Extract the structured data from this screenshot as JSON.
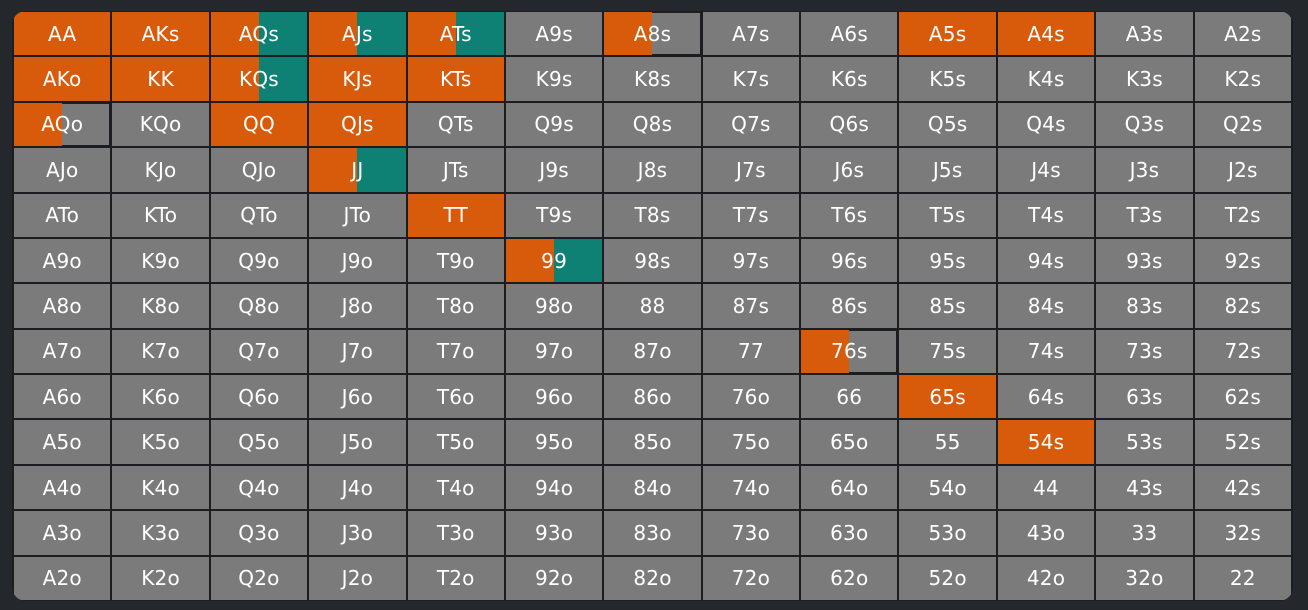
{
  "colors": {
    "raise": "#d85a0b",
    "call": "#0f8174",
    "fold": "#7b7b7b",
    "border": "#1b1d20"
  },
  "grid": {
    "rows": [
      [
        "AA",
        "AKs",
        "AQs",
        "AJs",
        "ATs",
        "A9s",
        "A8s",
        "A7s",
        "A6s",
        "A5s",
        "A4s",
        "A3s",
        "A2s"
      ],
      [
        "AKo",
        "KK",
        "KQs",
        "KJs",
        "KTs",
        "K9s",
        "K8s",
        "K7s",
        "K6s",
        "K5s",
        "K4s",
        "K3s",
        "K2s"
      ],
      [
        "AQo",
        "KQo",
        "QQ",
        "QJs",
        "QTs",
        "Q9s",
        "Q8s",
        "Q7s",
        "Q6s",
        "Q5s",
        "Q4s",
        "Q3s",
        "Q2s"
      ],
      [
        "AJo",
        "KJo",
        "QJo",
        "JJ",
        "JTs",
        "J9s",
        "J8s",
        "J7s",
        "J6s",
        "J5s",
        "J4s",
        "J3s",
        "J2s"
      ],
      [
        "ATo",
        "KTo",
        "QTo",
        "JTo",
        "TT",
        "T9s",
        "T8s",
        "T7s",
        "T6s",
        "T5s",
        "T4s",
        "T3s",
        "T2s"
      ],
      [
        "A9o",
        "K9o",
        "Q9o",
        "J9o",
        "T9o",
        "99",
        "98s",
        "97s",
        "96s",
        "95s",
        "94s",
        "93s",
        "92s"
      ],
      [
        "A8o",
        "K8o",
        "Q8o",
        "J8o",
        "T8o",
        "98o",
        "88",
        "87s",
        "86s",
        "85s",
        "84s",
        "83s",
        "82s"
      ],
      [
        "A7o",
        "K7o",
        "Q7o",
        "J7o",
        "T7o",
        "97o",
        "87o",
        "77",
        "76s",
        "75s",
        "74s",
        "73s",
        "72s"
      ],
      [
        "A6o",
        "K6o",
        "Q6o",
        "J6o",
        "T6o",
        "96o",
        "86o",
        "76o",
        "66",
        "65s",
        "64s",
        "63s",
        "62s"
      ],
      [
        "A5o",
        "K5o",
        "Q5o",
        "J5o",
        "T5o",
        "95o",
        "85o",
        "75o",
        "65o",
        "55",
        "54s",
        "53s",
        "52s"
      ],
      [
        "A4o",
        "K4o",
        "Q4o",
        "J4o",
        "T4o",
        "94o",
        "84o",
        "74o",
        "64o",
        "54o",
        "44",
        "43s",
        "42s"
      ],
      [
        "A3o",
        "K3o",
        "Q3o",
        "J3o",
        "T3o",
        "93o",
        "83o",
        "73o",
        "63o",
        "53o",
        "43o",
        "33",
        "32s"
      ],
      [
        "A2o",
        "K2o",
        "Q2o",
        "J2o",
        "T2o",
        "92o",
        "82o",
        "72o",
        "62o",
        "52o",
        "42o",
        "32o",
        "22"
      ]
    ],
    "frequencies": {
      "AA": {
        "raise": 1.0,
        "call": 0.0
      },
      "AKs": {
        "raise": 1.0,
        "call": 0.0
      },
      "AQs": {
        "raise": 0.5,
        "call": 0.5
      },
      "AJs": {
        "raise": 0.5,
        "call": 0.5
      },
      "ATs": {
        "raise": 0.5,
        "call": 0.5
      },
      "A8s": {
        "raise": 0.5,
        "call": 0.0
      },
      "A5s": {
        "raise": 1.0,
        "call": 0.0
      },
      "A4s": {
        "raise": 1.0,
        "call": 0.0
      },
      "AKo": {
        "raise": 1.0,
        "call": 0.0
      },
      "KK": {
        "raise": 1.0,
        "call": 0.0
      },
      "KQs": {
        "raise": 0.5,
        "call": 0.5
      },
      "KJs": {
        "raise": 1.0,
        "call": 0.0
      },
      "KTs": {
        "raise": 1.0,
        "call": 0.0
      },
      "AQo": {
        "raise": 0.5,
        "call": 0.0
      },
      "QQ": {
        "raise": 1.0,
        "call": 0.0
      },
      "QJs": {
        "raise": 1.0,
        "call": 0.0
      },
      "JJ": {
        "raise": 0.5,
        "call": 0.5
      },
      "TT": {
        "raise": 1.0,
        "call": 0.0
      },
      "99": {
        "raise": 0.5,
        "call": 0.5
      },
      "76s": {
        "raise": 0.5,
        "call": 0.0
      },
      "65s": {
        "raise": 1.0,
        "call": 0.0
      },
      "54s": {
        "raise": 1.0,
        "call": 0.0
      }
    }
  }
}
